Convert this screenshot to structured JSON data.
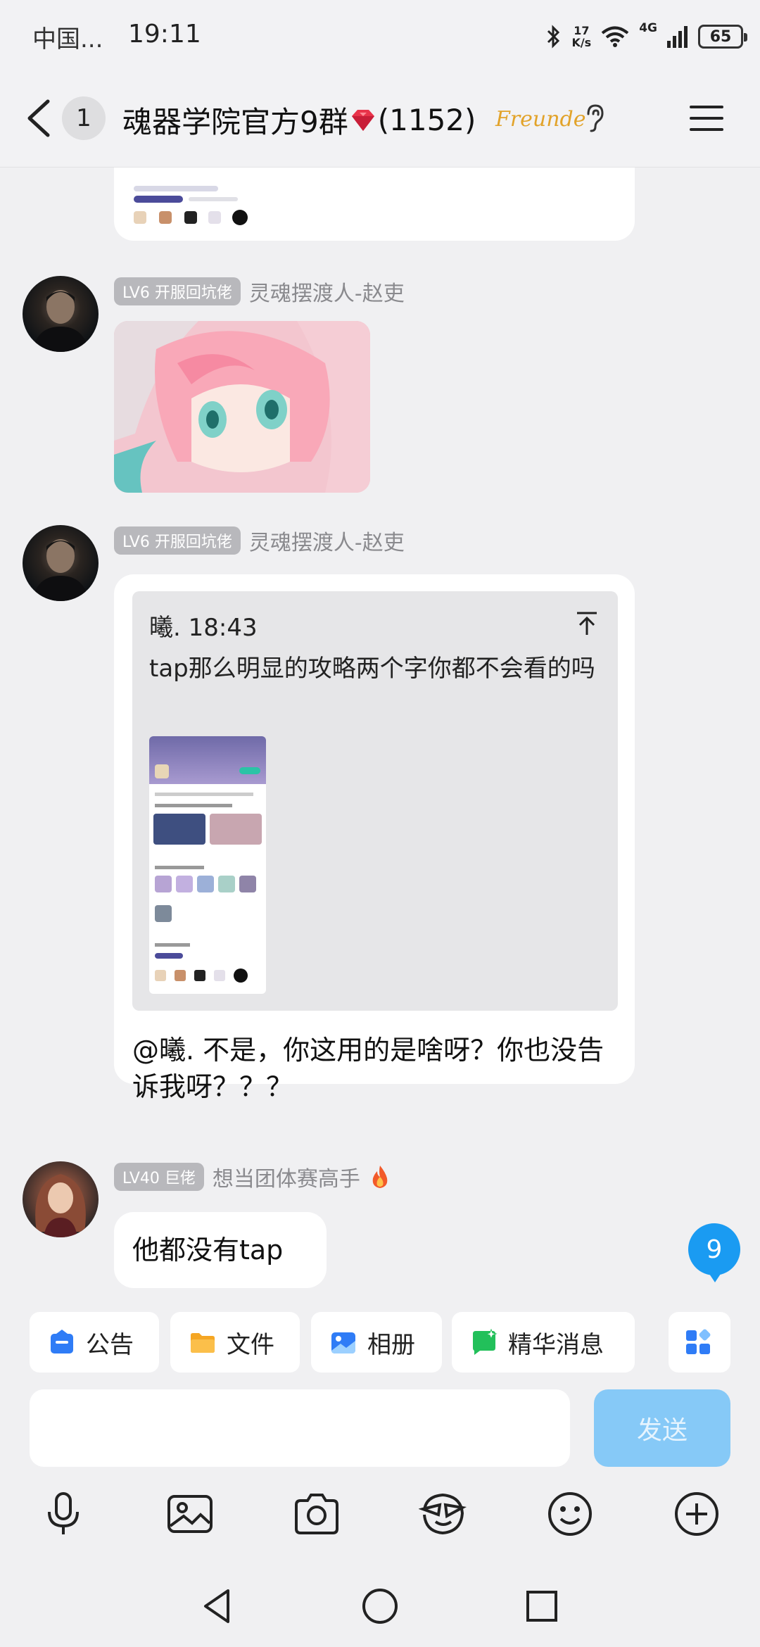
{
  "status_bar": {
    "carrier": "中国...",
    "time": "19:11",
    "speed_top": "17",
    "speed_unit": "K/s",
    "network": "4G",
    "battery": "65"
  },
  "header": {
    "unread_count": "1",
    "title_prefix": "魂器学院官方9群",
    "title_suffix": "(1152)",
    "badge_text": "Freunde"
  },
  "messages": [
    {
      "level": "LV6 开服回坑佬",
      "sender": "灵魂摆渡人-赵吏",
      "type": "image"
    },
    {
      "level": "LV6 开服回坑佬",
      "sender": "灵魂摆渡人-赵吏",
      "type": "reply",
      "quote_author_time": "曦. 18:43",
      "quote_text": "tap那么明显的攻略两个字你都不会看的吗",
      "text": "@曦. 不是，你这用的是啥呀？你也没告诉我呀？？？"
    },
    {
      "level": "LV40 巨佬",
      "sender": "想当团体赛高手",
      "type": "text",
      "text": "他都没有tap"
    }
  ],
  "new_message_count": "9",
  "quick_actions": [
    {
      "label": "公告",
      "icon": "announcement-icon",
      "color": "#2f7cf6"
    },
    {
      "label": "文件",
      "icon": "folder-icon",
      "color": "#f5a623"
    },
    {
      "label": "相册",
      "icon": "album-icon",
      "color": "#2f7cf6"
    },
    {
      "label": "精华消息",
      "icon": "highlight-message-icon",
      "color": "#22c05a"
    }
  ],
  "input": {
    "value": "",
    "placeholder": ""
  },
  "send_label": "发送",
  "toolbar_icons": [
    "microphone-icon",
    "image-icon",
    "camera-icon",
    "sticker-icon",
    "emoji-icon",
    "plus-icon"
  ],
  "colors": {
    "accent": "#1a9bf2",
    "send_disabled": "#86c9f7",
    "background": "#f0f0f2"
  }
}
